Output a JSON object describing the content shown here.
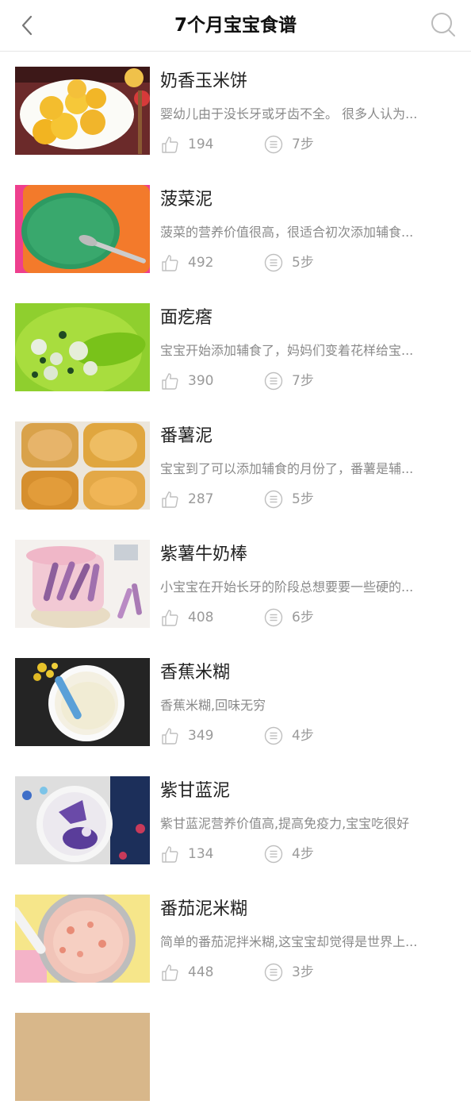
{
  "header": {
    "title": "7个月宝宝食谱"
  },
  "recipes": [
    {
      "name": "奶香玉米饼",
      "desc": "婴幼儿由于没长牙或牙齿不全。 很多人认为...",
      "likes": "194",
      "steps": "7步"
    },
    {
      "name": "菠菜泥",
      "desc": "菠菜的营养价值很高，很适合初次添加辅食...",
      "likes": "492",
      "steps": "5步"
    },
    {
      "name": "面疙瘩",
      "desc": "宝宝开始添加辅食了，妈妈们变着花样给宝...",
      "likes": "390",
      "steps": "7步"
    },
    {
      "name": "番薯泥",
      "desc": "宝宝到了可以添加辅食的月份了，番薯是辅...",
      "likes": "287",
      "steps": "5步"
    },
    {
      "name": "紫薯牛奶棒",
      "desc": "小宝宝在开始长牙的阶段总想要要一些硬的...",
      "likes": "408",
      "steps": "6步"
    },
    {
      "name": "香蕉米糊",
      "desc": "香蕉米糊,回味无穷",
      "likes": "349",
      "steps": "4步"
    },
    {
      "name": "紫甘蓝泥",
      "desc": "紫甘蓝泥营养价值高,提高免疫力,宝宝吃很好",
      "likes": "134",
      "steps": "4步"
    },
    {
      "name": "番茄泥米糊",
      "desc": "简单的番茄泥拌米糊,这宝宝却觉得是世界上...",
      "likes": "448",
      "steps": "3步"
    }
  ]
}
